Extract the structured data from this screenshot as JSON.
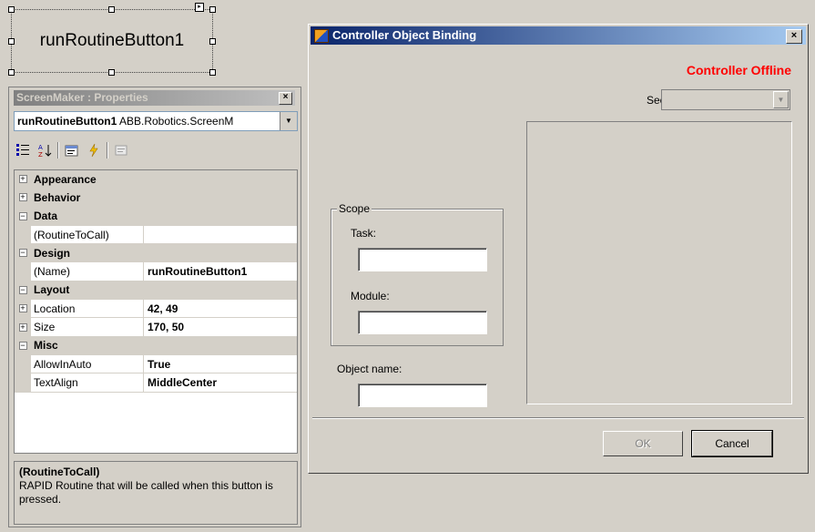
{
  "designer": {
    "button_text": "runRoutineButton1"
  },
  "properties": {
    "title": "ScreenMaker : Properties",
    "close_glyph": "×",
    "object_name": "runRoutineButton1",
    "object_type": "ABB.Robotics.ScreenM",
    "toolbar_icons": [
      "categorized-icon",
      "alphabetical-icon",
      "properties-icon",
      "events-icon",
      "property-pages-icon"
    ],
    "rows": [
      {
        "kind": "category",
        "expander": "+",
        "label": "Appearance"
      },
      {
        "kind": "category",
        "expander": "+",
        "label": "Behavior"
      },
      {
        "kind": "category",
        "expander": "−",
        "label": "Data"
      },
      {
        "kind": "property",
        "name": "(RoutineToCall)",
        "value": ""
      },
      {
        "kind": "category",
        "expander": "−",
        "label": "Design"
      },
      {
        "kind": "property",
        "name": "(Name)",
        "value": "runRoutineButton1"
      },
      {
        "kind": "category",
        "expander": "−",
        "label": "Layout"
      },
      {
        "kind": "property",
        "expander": "+",
        "name": "Location",
        "value": "42, 49"
      },
      {
        "kind": "property",
        "expander": "+",
        "name": "Size",
        "value": "170, 50"
      },
      {
        "kind": "category",
        "expander": "−",
        "label": "Misc"
      },
      {
        "kind": "property",
        "name": "AllowInAuto",
        "value": "True"
      },
      {
        "kind": "property",
        "name": "TextAlign",
        "value": "MiddleCenter"
      }
    ],
    "description": {
      "title": "(RoutineToCall)",
      "text": "RAPID Routine that will be called when this button is pressed."
    }
  },
  "dialog": {
    "title": "Controller Object Binding",
    "close_glyph": "×",
    "status": "Controller Offline",
    "status_color": "#ff0000",
    "see_label": "See:",
    "see_value": "",
    "scope_legend": "Scope",
    "task_label": "Task:",
    "task_value": "",
    "module_label": "Module:",
    "module_value": "",
    "object_name_label": "Object name:",
    "object_name_value": "",
    "ok_label": "OK",
    "cancel_label": "Cancel"
  },
  "colors": {
    "background": "#d4d0c8",
    "dialog_title_start": "#0a246a",
    "dialog_title_end": "#a6caf0"
  }
}
